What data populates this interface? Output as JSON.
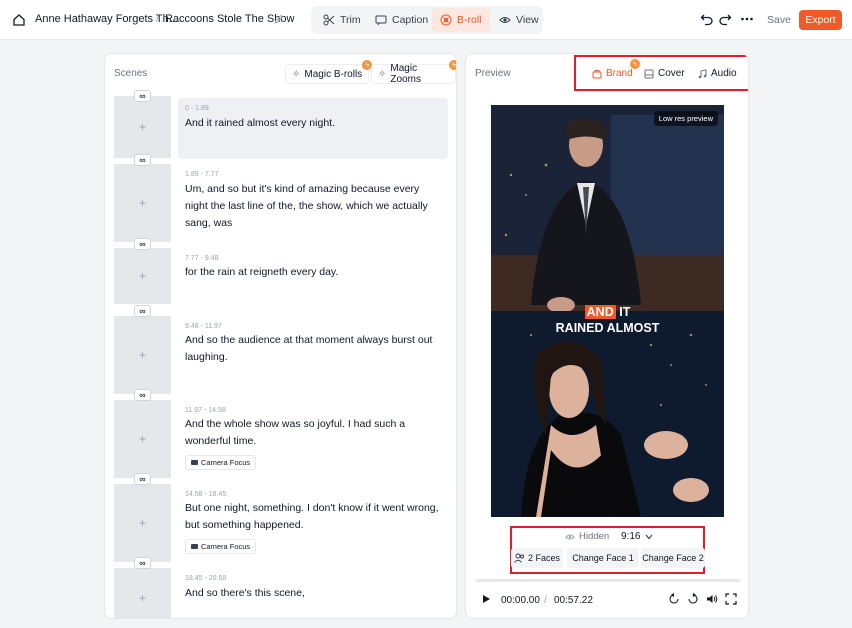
{
  "breadcrumb": {
    "project": "Anne Hathaway Forgets Th...",
    "separator": "/",
    "clip": "Raccoons Stole The Show"
  },
  "tabs": [
    {
      "label": "Trim",
      "icon": "scissors-icon"
    },
    {
      "label": "Caption",
      "icon": "caption-icon"
    },
    {
      "label": "B-roll",
      "icon": "broll-icon",
      "active": true
    },
    {
      "label": "View",
      "icon": "eye-icon"
    }
  ],
  "toolbar": {
    "save_label": "Save",
    "export_label": "Export"
  },
  "colors": {
    "accent": "#f05a28",
    "highlight_box": "#e11d2c"
  },
  "scenes_panel": {
    "title": "Scenes",
    "magic_brolls": "Magic B-rolls",
    "magic_zooms": "Magic Zooms",
    "add_symbol": "+",
    "link_symbol": "∞",
    "items": [
      {
        "time": "0 - 1.89",
        "text": "And it rained almost every night."
      },
      {
        "time": "1.89 - 7.77",
        "text": "Um, and so but it's kind of amazing because every night the last line of the, the show, which we actually sang, was"
      },
      {
        "time": "7.77 - 9.48",
        "text": "for the rain at reigneth every day."
      },
      {
        "time": "9.48 - 11.97",
        "text": "And so the audience at that moment always burst out laughing."
      },
      {
        "time": "11.97 - 14.58",
        "text": "And the whole show was so joyful. I had such a wonderful time.",
        "chip": "Camera Focus"
      },
      {
        "time": "14.58 - 18.45",
        "text": "But one night, something. I don't know if it went wrong, but something happened.",
        "chip": "Camera Focus"
      },
      {
        "time": "18.45 - 20.58",
        "text": "And so there's this scene,"
      }
    ]
  },
  "preview_panel": {
    "title": "Preview",
    "tab_brand": "Brand",
    "tab_cover": "Cover",
    "tab_audio": "Audio",
    "low_res": "Low res preview",
    "caption_highlight": "AND",
    "caption_rest": "IT",
    "caption_line2": "RAINED ALMOST",
    "hidden_label": "Hidden",
    "aspect_ratio": "9:16",
    "faces_label": "2 Faces",
    "change_face_1": "Change Face 1",
    "change_face_2": "Change Face 2",
    "current_time": "00:00.00",
    "time_separator": "/",
    "total_time": "00:57.22",
    "progress": 0
  }
}
